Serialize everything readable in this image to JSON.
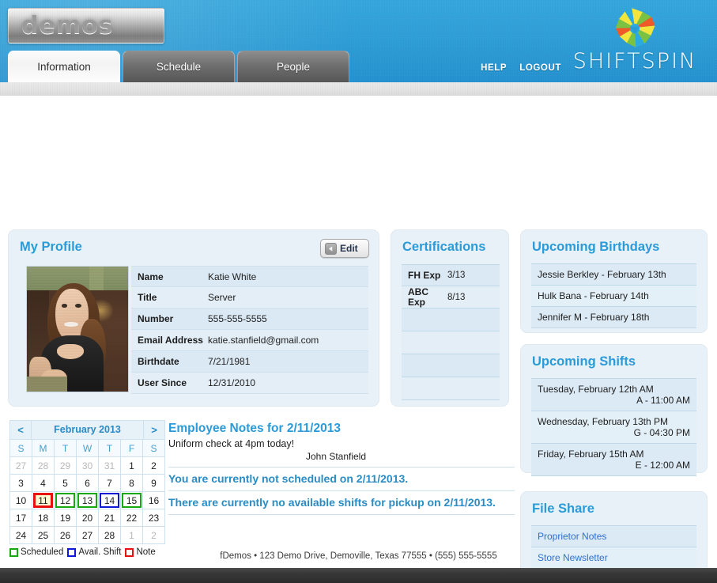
{
  "header": {
    "logo_text": "demos",
    "brand_name": "SHIFTSPIN",
    "brand_mark_icon": "pinwheel-starburst-icon",
    "tabs": [
      {
        "label": "Information",
        "active": true
      },
      {
        "label": "Schedule",
        "active": false
      },
      {
        "label": "People",
        "active": false
      }
    ],
    "links": [
      {
        "label": "HELP"
      },
      {
        "label": "LOGOUT"
      }
    ]
  },
  "profile": {
    "title": "My Profile",
    "edit_label": "Edit",
    "edit_icon": "back-arrow-circle-icon",
    "photo_alt": "profile-photo",
    "rows": [
      {
        "key": "Name",
        "value": "Katie White"
      },
      {
        "key": "Title",
        "value": "Server"
      },
      {
        "key": "Number",
        "value": "555-555-5555"
      },
      {
        "key": "Email Address",
        "value": "katie.stanfield@gmail.com"
      },
      {
        "key": "Birthdate",
        "value": "7/21/1981"
      },
      {
        "key": "User Since",
        "value": "12/31/2010"
      }
    ]
  },
  "certifications": {
    "title": "Certifications",
    "rows": [
      {
        "key": "FH Exp",
        "value": "3/13"
      },
      {
        "key": "ABC Exp",
        "value": "8/13"
      },
      {
        "key": "",
        "value": ""
      },
      {
        "key": "",
        "value": ""
      },
      {
        "key": "",
        "value": ""
      },
      {
        "key": "",
        "value": ""
      }
    ]
  },
  "birthdays": {
    "title": "Upcoming Birthdays",
    "items": [
      "Jessie Berkley - February 13th",
      "Hulk Bana - February 14th",
      "Jennifer M - February 18th"
    ]
  },
  "shifts": {
    "title": "Upcoming Shifts",
    "items": [
      {
        "line1": "Tuesday, February 12th AM",
        "line2": "A - 11:00 AM"
      },
      {
        "line1": "Wednesday, February 13th PM",
        "line2": "G - 04:30 PM"
      },
      {
        "line1": "Friday, February 15th AM",
        "line2": "E - 12:00 AM"
      }
    ]
  },
  "file_share": {
    "title": "File Share",
    "items": [
      "Proprietor Notes",
      "Store Newsletter"
    ]
  },
  "calendar": {
    "prev_label": "<",
    "next_label": ">",
    "month_title": "February 2013",
    "dow": [
      "S",
      "M",
      "T",
      "W",
      "T",
      "F",
      "S"
    ],
    "weeks": [
      [
        {
          "d": "27",
          "muted": true
        },
        {
          "d": "28",
          "muted": true
        },
        {
          "d": "29",
          "muted": true
        },
        {
          "d": "30",
          "muted": true
        },
        {
          "d": "31",
          "muted": true
        },
        {
          "d": "1"
        },
        {
          "d": "2"
        }
      ],
      [
        {
          "d": "3"
        },
        {
          "d": "4"
        },
        {
          "d": "5"
        },
        {
          "d": "6"
        },
        {
          "d": "7"
        },
        {
          "d": "8"
        },
        {
          "d": "9"
        }
      ],
      [
        {
          "d": "10"
        },
        {
          "d": "11",
          "mark": "note"
        },
        {
          "d": "12",
          "mark": "scheduled"
        },
        {
          "d": "13",
          "mark": "scheduled"
        },
        {
          "d": "14",
          "mark": "avail"
        },
        {
          "d": "15",
          "mark": "scheduled"
        },
        {
          "d": "16"
        }
      ],
      [
        {
          "d": "17"
        },
        {
          "d": "18"
        },
        {
          "d": "19"
        },
        {
          "d": "20"
        },
        {
          "d": "21"
        },
        {
          "d": "22"
        },
        {
          "d": "23"
        }
      ],
      [
        {
          "d": "24"
        },
        {
          "d": "25"
        },
        {
          "d": "26"
        },
        {
          "d": "27"
        },
        {
          "d": "28"
        },
        {
          "d": "1",
          "muted": true
        },
        {
          "d": "2",
          "muted": true
        }
      ]
    ],
    "legend": [
      {
        "label": "Scheduled",
        "color": "#18a80f"
      },
      {
        "label": "Avail. Shift",
        "color": "#1018d8"
      },
      {
        "label": "Note",
        "color": "#e81010"
      }
    ]
  },
  "notes": {
    "title": "Employee Notes for 2/11/2013",
    "body": "Uniform check at 4pm today!",
    "signature": "John Stanfield",
    "message_scheduled": "You are currently not scheduled on 2/11/2013.",
    "message_pickup": "There are currently no available shifts for pickup on 2/11/2013."
  },
  "footer": {
    "text": "fDemos • 123 Demo Drive, Demoville, Texas 77555 • (555) 555-5555"
  },
  "colors": {
    "header_blue": "#2e9ed6",
    "panel_bg": "#e8f1f8",
    "title_blue": "#2a9bd8",
    "link_blue": "#2f6fd0",
    "scheduled_green": "#18a80f",
    "avail_blue": "#1018d8",
    "note_red": "#e81010"
  }
}
